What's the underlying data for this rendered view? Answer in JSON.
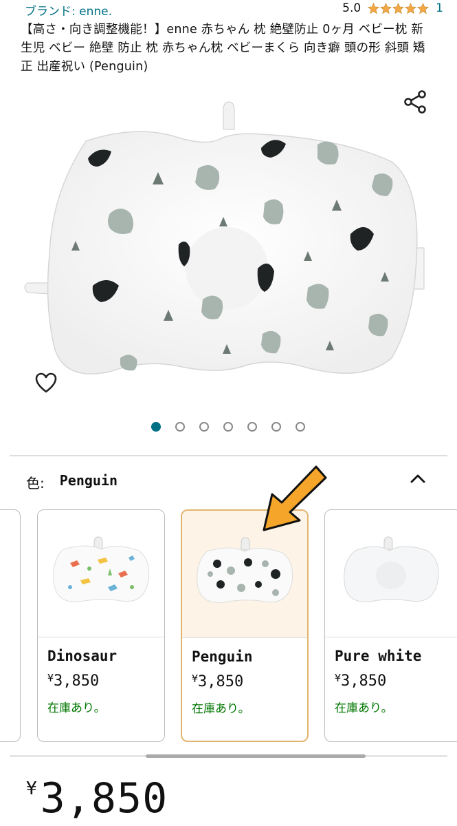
{
  "header": {
    "brand": "ブランド: enne.",
    "rating_value": "5.0",
    "rating_stars": 5,
    "rating_count": "1",
    "title": "【高さ・向き調整機能！】enne 赤ちゃん 枕 絶壁防止 0ヶ月 ベビー枕 新生児 ベビー 絶壁 防止 枕 赤ちゃん枕 ベビーまくら 向き癖 頭の形 斜頭 矯正 出産祝い (Penguin)"
  },
  "icons": {
    "share": "share-icon",
    "favorite": "heart-icon",
    "collapse": "chevron-up-icon"
  },
  "gallery": {
    "image_count": 7,
    "active_index": 0
  },
  "color_selector": {
    "label": "色:",
    "value": "Penguin"
  },
  "variants": [
    {
      "name": "Dinosaur",
      "price": "3,850",
      "currency": "¥",
      "stock": "在庫あり。",
      "selected": false
    },
    {
      "name": "Penguin",
      "price": "3,850",
      "currency": "¥",
      "stock": "在庫あり。",
      "selected": true
    },
    {
      "name": "Pure white",
      "price": "3,850",
      "currency": "¥",
      "stock": "在庫あり。",
      "selected": false
    }
  ],
  "price": {
    "currency": "¥",
    "amount": "3,850"
  },
  "colors": {
    "link": "#007185",
    "star": "#f3a847",
    "in_stock": "#007600",
    "selected_border": "#e3b46f",
    "annotation_arrow": "#f5a52a"
  }
}
